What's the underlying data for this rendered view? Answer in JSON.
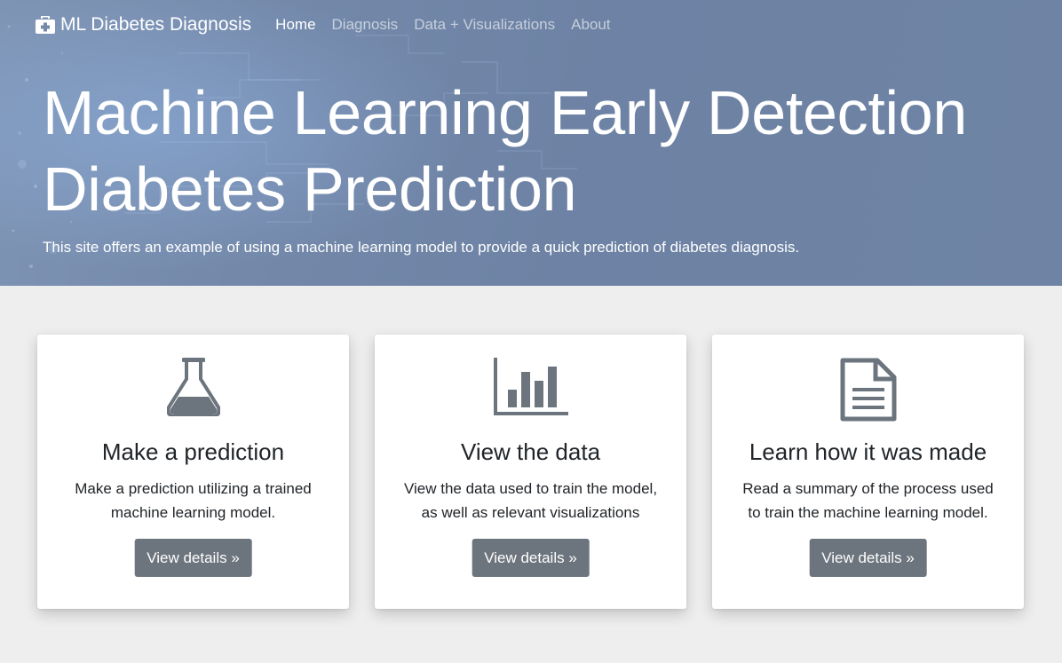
{
  "nav": {
    "brand": "ML Diabetes Diagnosis",
    "links": [
      {
        "label": "Home",
        "active": true
      },
      {
        "label": "Diagnosis",
        "active": false
      },
      {
        "label": "Data + Visualizations",
        "active": false
      },
      {
        "label": "About",
        "active": false
      }
    ]
  },
  "hero": {
    "title_line1": "Machine Learning Early Detection",
    "title_line2": "Diabetes Prediction",
    "subtitle": "This site offers an example of using a machine learning model to provide a quick prediction of diabetes diagnosis."
  },
  "cards": [
    {
      "icon": "flask-icon",
      "title": "Make a prediction",
      "text_line1": "Make a prediction utilizing a trained",
      "text_line2": "machine learning model.",
      "button": "View details »"
    },
    {
      "icon": "bar-chart-icon",
      "title": "View the data",
      "text_line1": "View the data used to train the model,",
      "text_line2": "as well as relevant visualizations",
      "button": "View details »"
    },
    {
      "icon": "document-icon",
      "title": "Learn how it was made",
      "text_line1": "Read a summary of the process used",
      "text_line2": "to train the machine learning model.",
      "button": "View details »"
    }
  ],
  "colors": {
    "hero_bg": "#7087a8",
    "button_bg": "#6c757d",
    "icon": "#6c757d",
    "page_bg": "#eeeeee"
  }
}
